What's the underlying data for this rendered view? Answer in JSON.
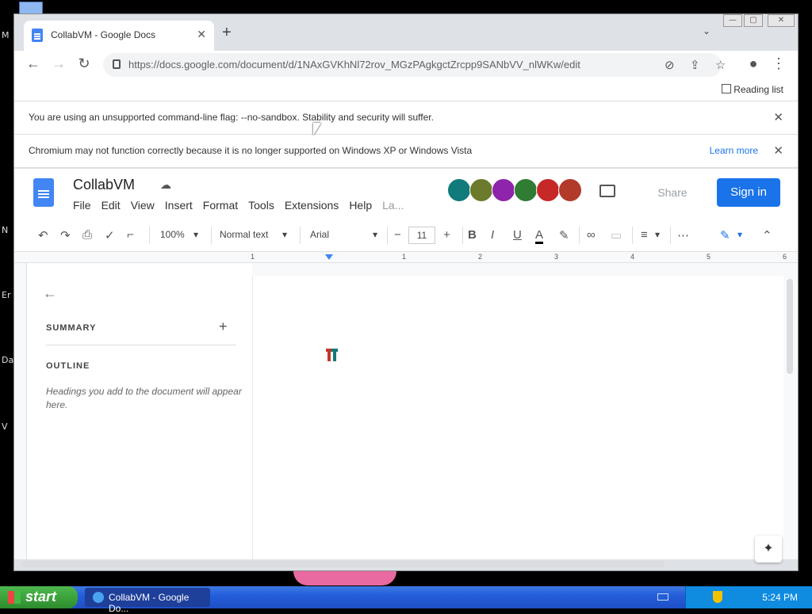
{
  "browser": {
    "tab_title": "CollabVM - Google Docs",
    "url": "https://docs.google.com/document/d/1NAxGVKhNl72rov_MGzPAgkgctZrcpp9SANbVV_nlWKw/edit",
    "reading_list": "Reading list"
  },
  "infobars": {
    "sandbox_msg": "You are using an unsupported command-line flag: --no-sandbox. Stability and security will suffer.",
    "xp_msg": "Chromium may not function correctly because it is no longer supported on Windows XP or Windows Vista",
    "learn_more": "Learn more"
  },
  "docs": {
    "title": "CollabVM",
    "menu": [
      "File",
      "Edit",
      "View",
      "Insert",
      "Format",
      "Tools",
      "Extensions",
      "Help",
      "La..."
    ],
    "share": "Share",
    "sign_in": "Sign in",
    "accent": "#1a73e8"
  },
  "toolbar": {
    "zoom": "100%",
    "style": "Normal text",
    "font": "Arial",
    "font_size": "11"
  },
  "ruler": [
    "1",
    "1",
    "2",
    "3",
    "4",
    "5",
    "6"
  ],
  "outline": {
    "summary": "SUMMARY",
    "outline": "OUTLINE",
    "hint": "Headings you add to the document will appear here."
  },
  "taskbar": {
    "start": "start",
    "task": "CollabVM - Google Do...",
    "clock": "5:24 PM"
  },
  "desktop_labels": [
    "M",
    "N",
    "Er",
    "Da",
    "V"
  ]
}
